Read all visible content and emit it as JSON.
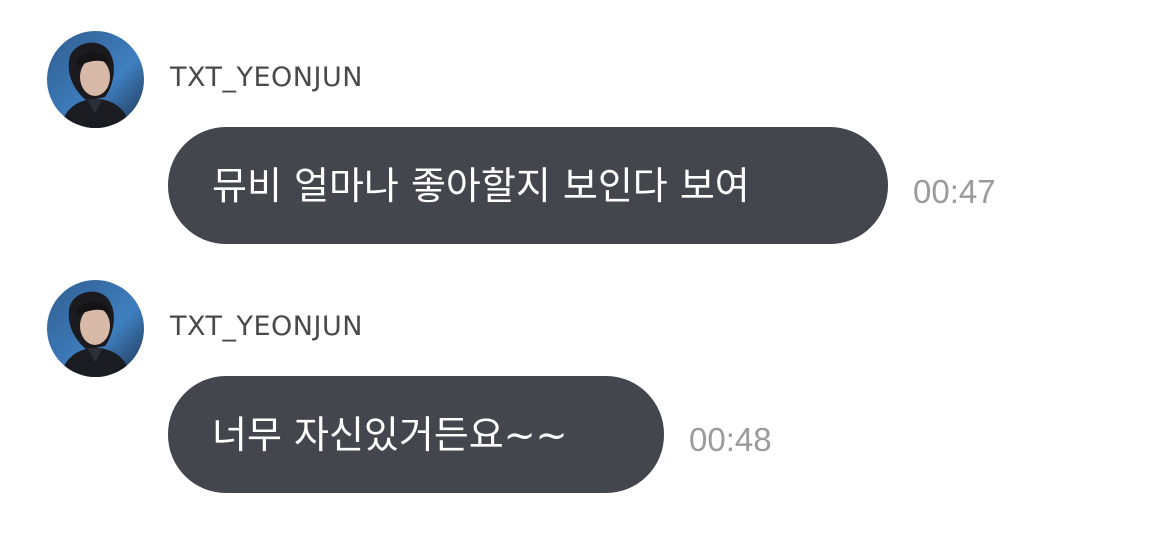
{
  "messages": [
    {
      "sender": "TXT_YEONJUN",
      "avatar_icon": "profile-photo-avatar",
      "text": "뮤비 얼마나 좋아할지 보인다 보여",
      "time": "00:47"
    },
    {
      "sender": "TXT_YEONJUN",
      "avatar_icon": "profile-photo-avatar",
      "text": "너무 자신있거든요~~",
      "time": "00:48"
    }
  ],
  "colors": {
    "bubble": "#43464d",
    "bubble_text": "#ffffff",
    "sender_text": "#4a4a4a",
    "time_text": "#9b9b9b",
    "background": "#ffffff"
  }
}
